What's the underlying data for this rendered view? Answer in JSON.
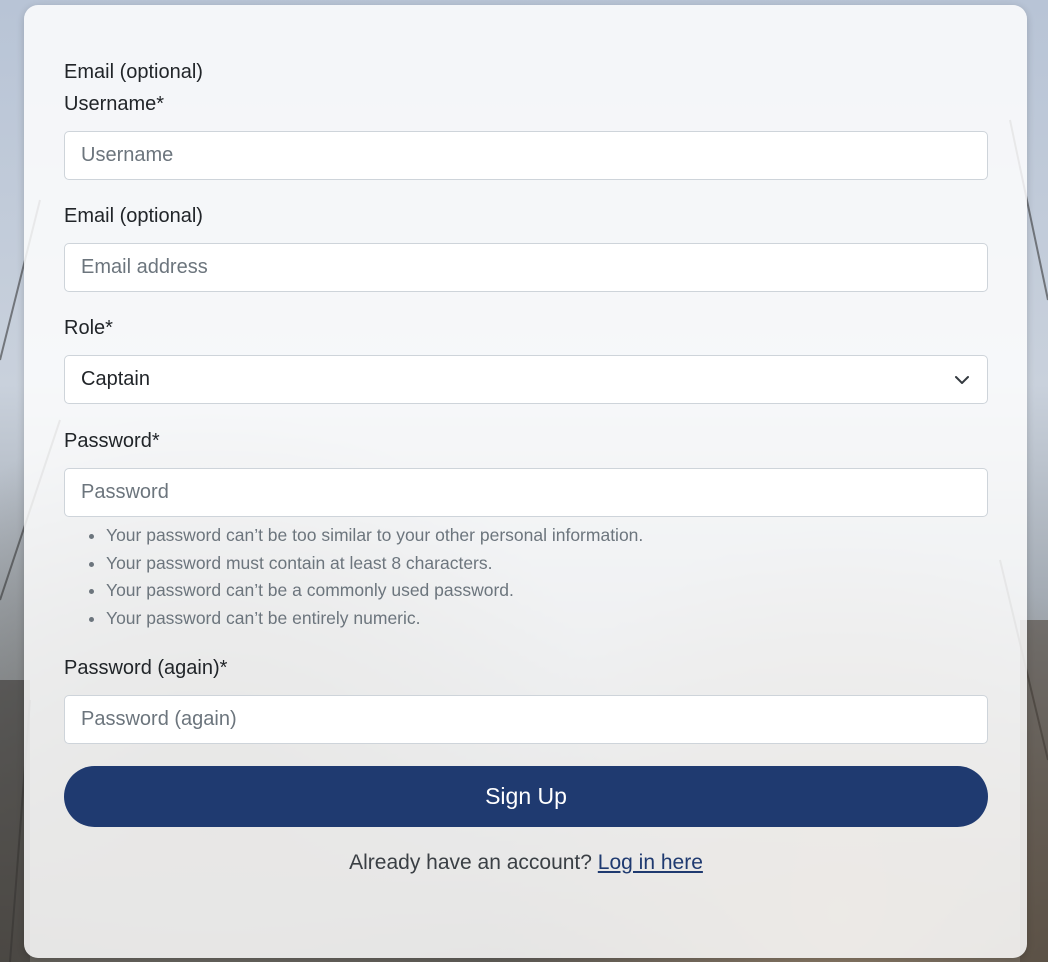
{
  "form": {
    "stray_label": "Email (optional)",
    "username": {
      "label": "Username*",
      "placeholder": "Username"
    },
    "email": {
      "label": "Email (optional)",
      "placeholder": "Email address"
    },
    "role": {
      "label": "Role*",
      "selected": "Captain",
      "icon": "chevron-down-icon"
    },
    "password": {
      "label": "Password*",
      "placeholder": "Password",
      "help": [
        "Your password can’t be too similar to your other personal information.",
        "Your password must contain at least 8 characters.",
        "Your password can’t be a commonly used password.",
        "Your password can’t be entirely numeric."
      ]
    },
    "password_again": {
      "label": "Password (again)*",
      "placeholder": "Password (again)"
    },
    "submit_label": "Sign Up",
    "footer": {
      "prompt": "Already have an account?",
      "link": "Log in here"
    }
  },
  "colors": {
    "primary": "#1f3a70",
    "muted_text": "#6c757d",
    "border": "#ced4da"
  }
}
